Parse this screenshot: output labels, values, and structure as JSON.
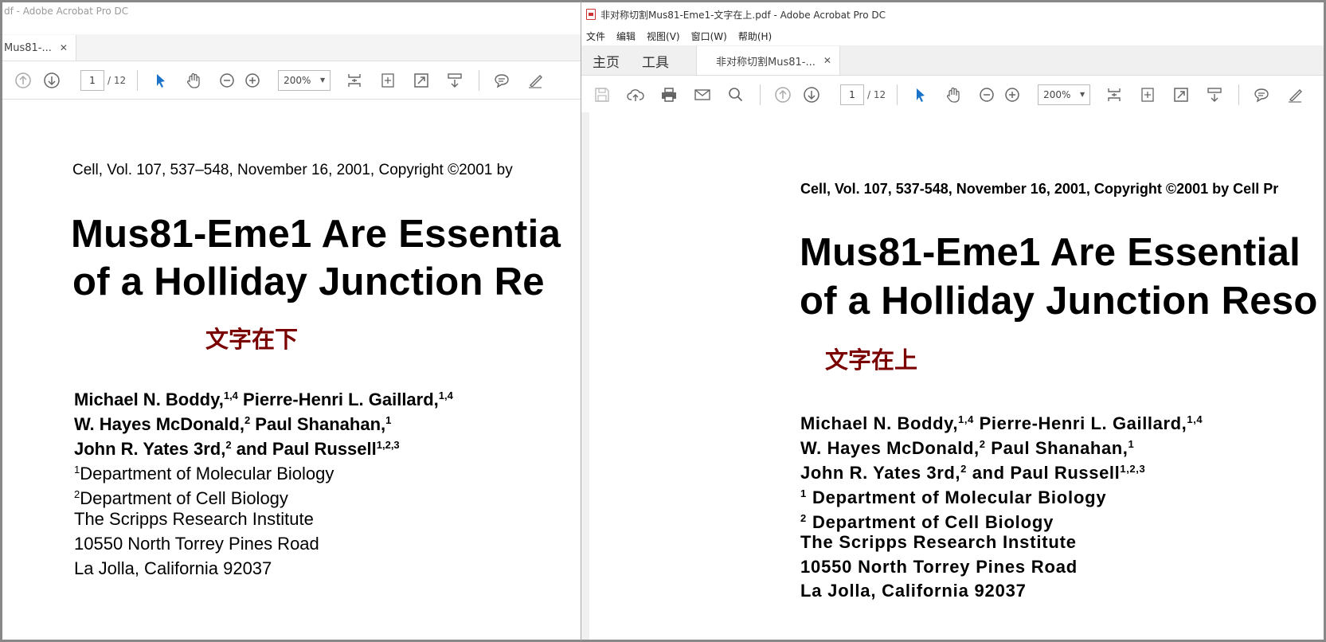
{
  "left": {
    "title": "df - Adobe Acrobat Pro DC",
    "menu": [
      ""
    ],
    "tab_label": "Mus81-...",
    "page_current": "1",
    "page_total": "/ 12",
    "zoom": "200%",
    "doc": {
      "citation": "Cell, Vol. 107, 537–548, November 16, 2001, Copyright ©2001 by",
      "title_line1": "Mus81-Eme1 Are Essentia",
      "title_line2": "of a Holliday Junction Re",
      "tag": "文字在下",
      "authors": [
        {
          "name": "Michael N. Boddy,",
          "sup": "1,4",
          "name2": " Pierre-Henri L. Gaillard,",
          "sup2": "1,4"
        },
        {
          "name": "W. Hayes McDonald,",
          "sup": "2",
          "name2": " Paul Shanahan,",
          "sup2": "1"
        },
        {
          "name": "John R. Yates 3rd,",
          "sup": "2",
          "name2": " and Paul Russell",
          "sup2": "1,2,3"
        }
      ],
      "affil_sup1": "1",
      "affil_line1": "Department of Molecular Biology",
      "affil_sup2": "2",
      "affil_line2": "Department of Cell Biology",
      "affil_line3": "The Scripps Research Institute",
      "affil_line4": "10550 North Torrey Pines Road",
      "affil_line5": "La Jolla, California 92037"
    }
  },
  "right": {
    "title": "非对称切割Mus81-Eme1-文字在上.pdf - Adobe Acrobat Pro DC",
    "menu": [
      "文件",
      "编辑",
      "视图(V)",
      "窗口(W)",
      "帮助(H)"
    ],
    "nav_home": "主页",
    "nav_tools": "工具",
    "tab_label": "非对称切割Mus81-...",
    "page_current": "1",
    "page_total": "/ 12",
    "zoom": "200%",
    "doc": {
      "citation": "Cell, Vol. 107, 537-548, November 16, 2001, Copyright ©2001 by Cell Pr",
      "title_line1": "Mus81-Eme1 Are Essential",
      "title_line2": "of a Holliday Junction Reso",
      "tag": "文字在上",
      "authors": [
        {
          "name": "Michael N. Boddy,",
          "sup": "1,4",
          "name2": " Pierre-Henri L. Gaillard,",
          "sup2": "1,4"
        },
        {
          "name": "W. Hayes McDonald,",
          "sup": "2",
          "name2": " Paul Shanahan,",
          "sup2": "1"
        },
        {
          "name": "John R. Yates 3rd,",
          "sup": "2",
          "name2": " and Paul Russell",
          "sup2": "1,2,3"
        }
      ],
      "affil_sup1": "1",
      "affil_line1": "Department of Molecular Biology",
      "affil_sup2": "2",
      "affil_line2": "Department of Cell Biology",
      "affil_line3": "The Scripps Research Institute",
      "affil_line4": "10550 North Torrey Pines Road",
      "affil_line5": "La Jolla, California 92037"
    }
  },
  "colors": {
    "tag": "#7a0000",
    "selected_tool": "#1a73c8",
    "icon_gray": "#777777"
  },
  "icons": [
    "prev-page-icon",
    "next-page-icon",
    "select-cursor-icon",
    "hand-icon",
    "zoom-out-icon",
    "zoom-in-icon",
    "fit-page-icon",
    "marquee-icon",
    "fullscreen-icon",
    "scroll-mode-icon",
    "comment-icon",
    "highlight-pen-icon",
    "save-icon",
    "upload-icon",
    "print-icon",
    "email-icon",
    "search-icon"
  ]
}
